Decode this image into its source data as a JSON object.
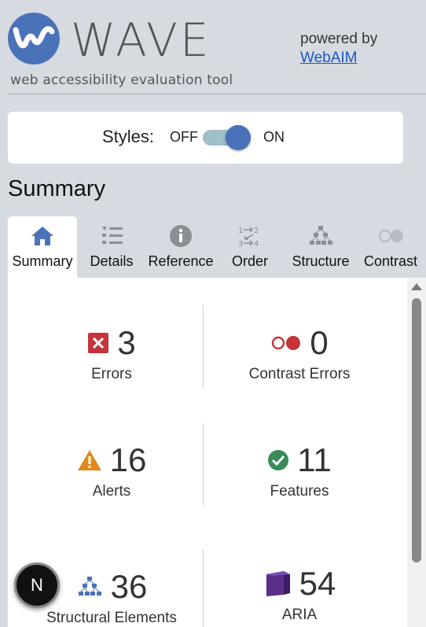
{
  "header": {
    "logo_text": "WAVE",
    "tagline": "web accessibility evaluation tool",
    "powered_by": "powered by",
    "webaim_link": "WebAIM"
  },
  "styles_toggle": {
    "label": "Styles:",
    "off": "OFF",
    "on": "ON",
    "state": "on"
  },
  "section_title": "Summary",
  "tabs": [
    {
      "label": "Summary",
      "icon": "home-icon",
      "active": true
    },
    {
      "label": "Details",
      "icon": "list-icon",
      "active": false
    },
    {
      "label": "Reference",
      "icon": "info-icon",
      "active": false
    },
    {
      "label": "Order",
      "icon": "order-icon",
      "active": false
    },
    {
      "label": "Structure",
      "icon": "structure-icon",
      "active": false
    },
    {
      "label": "Contrast",
      "icon": "contrast-icon",
      "active": false
    }
  ],
  "stats": {
    "errors": {
      "count": "3",
      "label": "Errors",
      "icon": "error-icon",
      "color": "#c6333a"
    },
    "contrast_errors": {
      "count": "0",
      "label": "Contrast Errors",
      "icon": "contrast-error-icon",
      "color": "#c6333a"
    },
    "alerts": {
      "count": "16",
      "label": "Alerts",
      "icon": "alert-icon",
      "color": "#e08a1a"
    },
    "features": {
      "count": "11",
      "label": "Features",
      "icon": "feature-icon",
      "color": "#3a8a5a"
    },
    "structural": {
      "count": "36",
      "label": "Structural Elements",
      "icon": "structural-icon",
      "color": "#4a72b8"
    },
    "aria": {
      "count": "54",
      "label": "ARIA",
      "icon": "aria-icon",
      "color": "#5a2f8a"
    }
  },
  "floating_button": {
    "label": "N"
  },
  "colors": {
    "accent": "#4a72b8",
    "background": "#d6dbe2",
    "link": "#1a56c4"
  }
}
